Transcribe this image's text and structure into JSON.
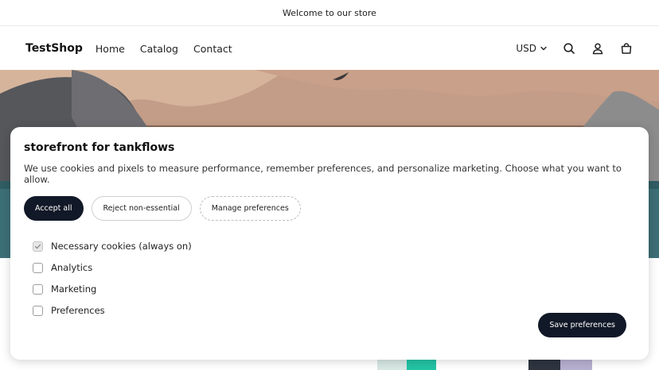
{
  "announcement": "Welcome to our store",
  "header": {
    "brand": "TestShop",
    "nav": [
      "Home",
      "Catalog",
      "Contact"
    ],
    "currency": "USD"
  },
  "modal": {
    "title": "storefront for tankflows",
    "description": "We use cookies and pixels to measure performance, remember preferences, and personalize marketing. Choose what you want to allow.",
    "buttons": {
      "accept_all": "Accept all",
      "reject": "Reject non-essential",
      "manage": "Manage preferences"
    },
    "options": [
      {
        "label": "Necessary cookies (always on)",
        "checked": true
      },
      {
        "label": "Analytics",
        "checked": false
      },
      {
        "label": "Marketing",
        "checked": false
      },
      {
        "label": "Preferences",
        "checked": false
      }
    ],
    "save_label": "Save preferences"
  },
  "icons": {
    "search": "search-icon",
    "account": "user-icon",
    "cart": "cart-icon",
    "chevron": "chevron-down-icon",
    "check": "check-icon"
  },
  "colors": {
    "primary_button": "#111827",
    "hero_sky": "#8a6a5a",
    "hero_water": "#3d6f76"
  }
}
